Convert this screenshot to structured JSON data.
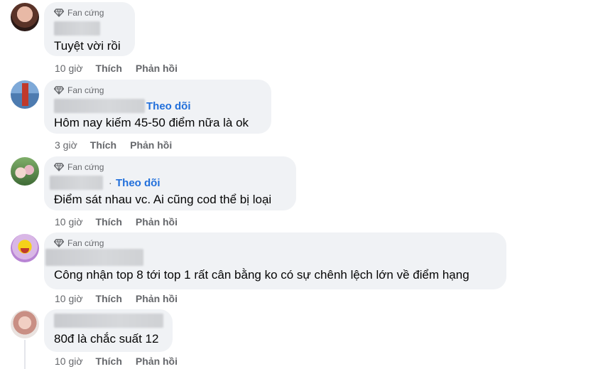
{
  "comments": [
    {
      "badge": "Fan cứng",
      "follow": "",
      "text": "Tuyệt vời rồi",
      "time": "10 giờ",
      "like": "Thích",
      "reply": "Phản hồi"
    },
    {
      "badge": "Fan cứng",
      "follow": "Theo dõi",
      "text": "Hôm nay kiếm 45-50 điểm nữa là ok",
      "time": "3 giờ",
      "like": "Thích",
      "reply": "Phản hồi"
    },
    {
      "badge": "Fan cứng",
      "follow": "Theo dõi",
      "separator": "·",
      "text": "Điểm sát nhau vc. Ai cũng cod thể bị loại",
      "time": "10 giờ",
      "like": "Thích",
      "reply": "Phản hồi"
    },
    {
      "badge": "Fan cứng",
      "follow": "",
      "text": "Công nhận top 8 tới top 1 rất cân bằng ko có sự chênh lệch lớn về điểm hạng",
      "time": "10 giờ",
      "like": "Thích",
      "reply": "Phản hồi"
    },
    {
      "badge": "",
      "follow": "",
      "text": "80đ là chắc suất 12",
      "time": "10 giờ",
      "like": "Thích",
      "reply": "Phản hồi"
    }
  ],
  "icons": {
    "badge_icon": "diamond-icon"
  },
  "colors": {
    "bubble": "#f0f2f5",
    "follow": "#216fdb",
    "meta": "#65676b",
    "text": "#050505"
  }
}
